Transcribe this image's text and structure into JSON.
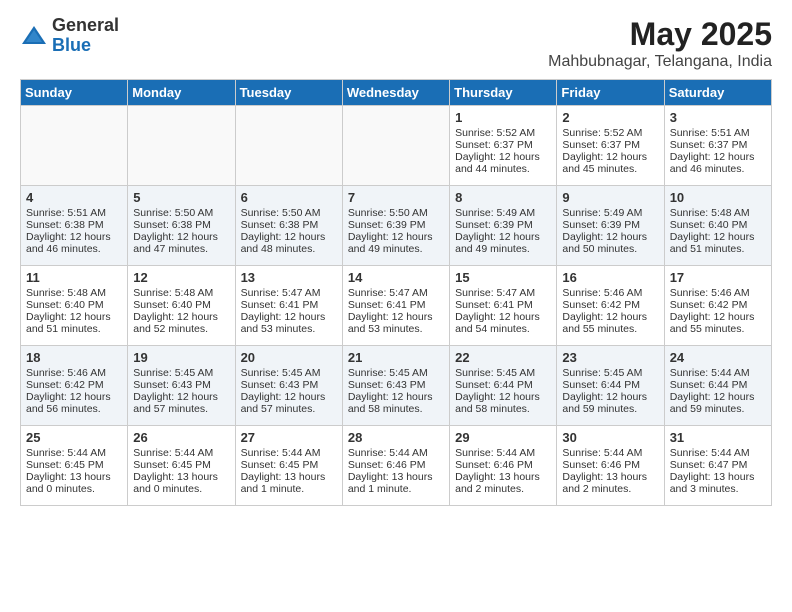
{
  "logo": {
    "general": "General",
    "blue": "Blue"
  },
  "title": {
    "month_year": "May 2025",
    "location": "Mahbubnagar, Telangana, India"
  },
  "headers": [
    "Sunday",
    "Monday",
    "Tuesday",
    "Wednesday",
    "Thursday",
    "Friday",
    "Saturday"
  ],
  "weeks": [
    [
      {
        "day": "",
        "text": ""
      },
      {
        "day": "",
        "text": ""
      },
      {
        "day": "",
        "text": ""
      },
      {
        "day": "",
        "text": ""
      },
      {
        "day": "1",
        "text": "Sunrise: 5:52 AM\nSunset: 6:37 PM\nDaylight: 12 hours\nand 44 minutes."
      },
      {
        "day": "2",
        "text": "Sunrise: 5:52 AM\nSunset: 6:37 PM\nDaylight: 12 hours\nand 45 minutes."
      },
      {
        "day": "3",
        "text": "Sunrise: 5:51 AM\nSunset: 6:37 PM\nDaylight: 12 hours\nand 46 minutes."
      }
    ],
    [
      {
        "day": "4",
        "text": "Sunrise: 5:51 AM\nSunset: 6:38 PM\nDaylight: 12 hours\nand 46 minutes."
      },
      {
        "day": "5",
        "text": "Sunrise: 5:50 AM\nSunset: 6:38 PM\nDaylight: 12 hours\nand 47 minutes."
      },
      {
        "day": "6",
        "text": "Sunrise: 5:50 AM\nSunset: 6:38 PM\nDaylight: 12 hours\nand 48 minutes."
      },
      {
        "day": "7",
        "text": "Sunrise: 5:50 AM\nSunset: 6:39 PM\nDaylight: 12 hours\nand 49 minutes."
      },
      {
        "day": "8",
        "text": "Sunrise: 5:49 AM\nSunset: 6:39 PM\nDaylight: 12 hours\nand 49 minutes."
      },
      {
        "day": "9",
        "text": "Sunrise: 5:49 AM\nSunset: 6:39 PM\nDaylight: 12 hours\nand 50 minutes."
      },
      {
        "day": "10",
        "text": "Sunrise: 5:48 AM\nSunset: 6:40 PM\nDaylight: 12 hours\nand 51 minutes."
      }
    ],
    [
      {
        "day": "11",
        "text": "Sunrise: 5:48 AM\nSunset: 6:40 PM\nDaylight: 12 hours\nand 51 minutes."
      },
      {
        "day": "12",
        "text": "Sunrise: 5:48 AM\nSunset: 6:40 PM\nDaylight: 12 hours\nand 52 minutes."
      },
      {
        "day": "13",
        "text": "Sunrise: 5:47 AM\nSunset: 6:41 PM\nDaylight: 12 hours\nand 53 minutes."
      },
      {
        "day": "14",
        "text": "Sunrise: 5:47 AM\nSunset: 6:41 PM\nDaylight: 12 hours\nand 53 minutes."
      },
      {
        "day": "15",
        "text": "Sunrise: 5:47 AM\nSunset: 6:41 PM\nDaylight: 12 hours\nand 54 minutes."
      },
      {
        "day": "16",
        "text": "Sunrise: 5:46 AM\nSunset: 6:42 PM\nDaylight: 12 hours\nand 55 minutes."
      },
      {
        "day": "17",
        "text": "Sunrise: 5:46 AM\nSunset: 6:42 PM\nDaylight: 12 hours\nand 55 minutes."
      }
    ],
    [
      {
        "day": "18",
        "text": "Sunrise: 5:46 AM\nSunset: 6:42 PM\nDaylight: 12 hours\nand 56 minutes."
      },
      {
        "day": "19",
        "text": "Sunrise: 5:45 AM\nSunset: 6:43 PM\nDaylight: 12 hours\nand 57 minutes."
      },
      {
        "day": "20",
        "text": "Sunrise: 5:45 AM\nSunset: 6:43 PM\nDaylight: 12 hours\nand 57 minutes."
      },
      {
        "day": "21",
        "text": "Sunrise: 5:45 AM\nSunset: 6:43 PM\nDaylight: 12 hours\nand 58 minutes."
      },
      {
        "day": "22",
        "text": "Sunrise: 5:45 AM\nSunset: 6:44 PM\nDaylight: 12 hours\nand 58 minutes."
      },
      {
        "day": "23",
        "text": "Sunrise: 5:45 AM\nSunset: 6:44 PM\nDaylight: 12 hours\nand 59 minutes."
      },
      {
        "day": "24",
        "text": "Sunrise: 5:44 AM\nSunset: 6:44 PM\nDaylight: 12 hours\nand 59 minutes."
      }
    ],
    [
      {
        "day": "25",
        "text": "Sunrise: 5:44 AM\nSunset: 6:45 PM\nDaylight: 13 hours\nand 0 minutes."
      },
      {
        "day": "26",
        "text": "Sunrise: 5:44 AM\nSunset: 6:45 PM\nDaylight: 13 hours\nand 0 minutes."
      },
      {
        "day": "27",
        "text": "Sunrise: 5:44 AM\nSunset: 6:45 PM\nDaylight: 13 hours\nand 1 minute."
      },
      {
        "day": "28",
        "text": "Sunrise: 5:44 AM\nSunset: 6:46 PM\nDaylight: 13 hours\nand 1 minute."
      },
      {
        "day": "29",
        "text": "Sunrise: 5:44 AM\nSunset: 6:46 PM\nDaylight: 13 hours\nand 2 minutes."
      },
      {
        "day": "30",
        "text": "Sunrise: 5:44 AM\nSunset: 6:46 PM\nDaylight: 13 hours\nand 2 minutes."
      },
      {
        "day": "31",
        "text": "Sunrise: 5:44 AM\nSunset: 6:47 PM\nDaylight: 13 hours\nand 3 minutes."
      }
    ]
  ]
}
